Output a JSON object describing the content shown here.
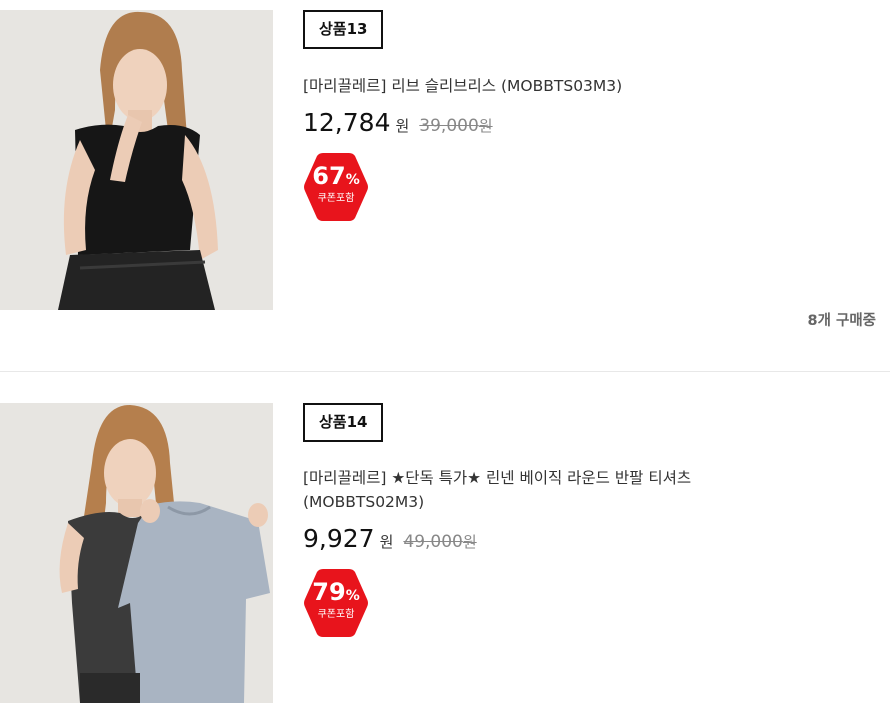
{
  "products": [
    {
      "badge": "상품13",
      "title": "[마리끌레르] 리브 슬리브리스 (MOBBTS03M3)",
      "price": "12,784",
      "price_unit": "원",
      "original_price": "39,000",
      "original_unit": "원",
      "discount_value": "67",
      "discount_unit": "%",
      "discount_note": "쿠폰포함",
      "buyers": "8개 구매중"
    },
    {
      "badge": "상품14",
      "title": "[마리끌레르] ★단독 특가★ 린넨 베이직 라운드 반팔 티셔츠 (MOBBTS02M3)",
      "price": "9,927",
      "price_unit": "원",
      "original_price": "49,000",
      "original_unit": "원",
      "discount_value": "79",
      "discount_unit": "%",
      "discount_note": "쿠폰포함"
    }
  ],
  "colors": {
    "discount_badge": "#e8141c",
    "divider": "#e8e8e8",
    "image_background": "#e7e5e1"
  }
}
